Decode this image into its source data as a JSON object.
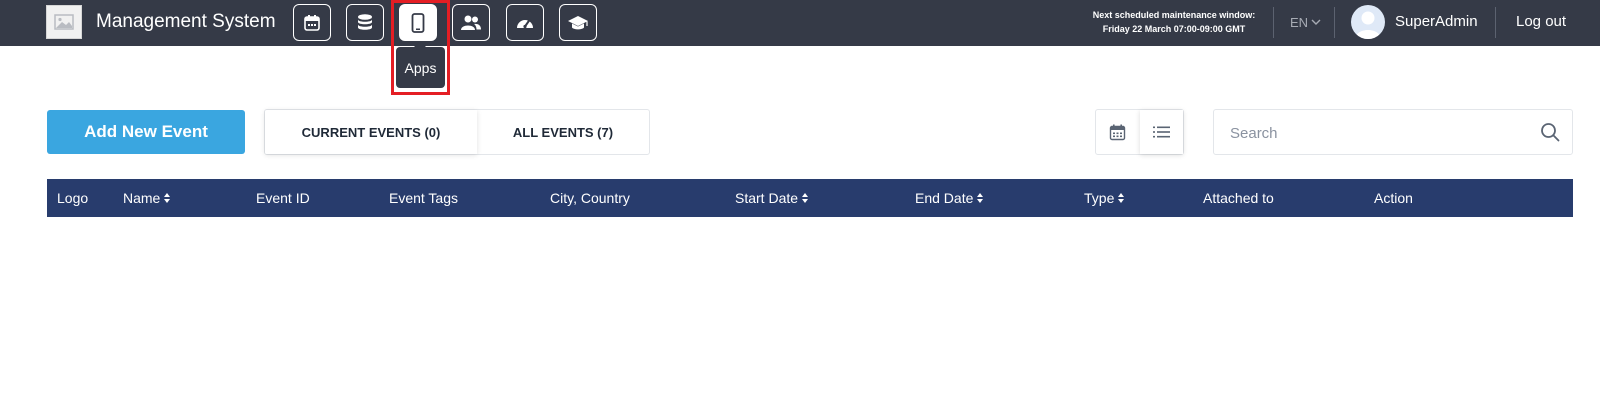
{
  "header": {
    "title": "Management System",
    "nav_icons": [
      "calendar-icon",
      "database-icon",
      "mobile-icon",
      "users-icon",
      "speedometer-icon",
      "graduation-cap-icon"
    ],
    "active_nav": "mobile-icon",
    "tooltip": "Apps",
    "maintenance_line1": "Next scheduled maintenance window:",
    "maintenance_line2": "Friday 22 March 07:00-09:00 GMT",
    "language": "EN",
    "user_name": "SuperAdmin",
    "logout_label": "Log out"
  },
  "toolbar": {
    "add_button": "Add New Event",
    "tabs": [
      "CURRENT EVENTS (0)",
      "ALL EVENTS (7)"
    ],
    "view_icons": [
      "calendar-view-icon",
      "list-view-icon"
    ],
    "search_placeholder": "Search"
  },
  "table": {
    "columns": [
      {
        "label": "Logo",
        "sortable": false
      },
      {
        "label": "Name",
        "sortable": true
      },
      {
        "label": "Event ID",
        "sortable": false
      },
      {
        "label": "Event Tags",
        "sortable": false
      },
      {
        "label": "City, Country",
        "sortable": false
      },
      {
        "label": "Start Date",
        "sortable": true
      },
      {
        "label": "End Date",
        "sortable": true
      },
      {
        "label": "Type",
        "sortable": true
      },
      {
        "label": "Attached to",
        "sortable": false
      },
      {
        "label": "Action",
        "sortable": false
      }
    ]
  },
  "colors": {
    "navbar": "#353a47",
    "accent": "#3aa6e0",
    "table_header": "#283c6d",
    "highlight": "#e41e24"
  }
}
